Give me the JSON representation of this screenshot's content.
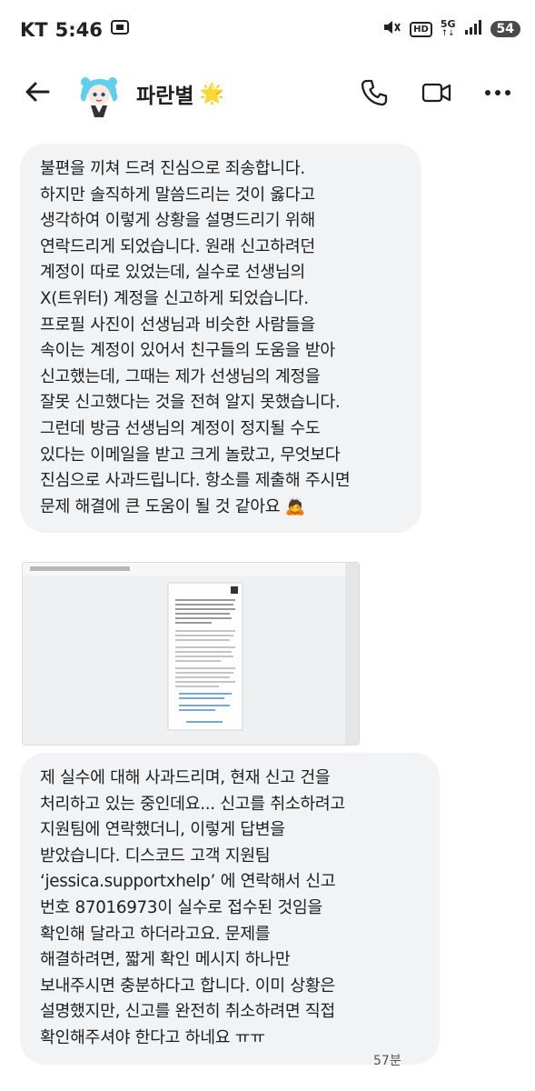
{
  "status_bar": {
    "carrier": "KT",
    "time": "5:46",
    "network": "5G",
    "hd": "HD",
    "battery": "54"
  },
  "header": {
    "contact_name": "파란별",
    "contact_emoji": "🌟"
  },
  "messages": [
    {
      "lines": [
        "불편을 끼쳐 드려 진심으로 죄송합니다.",
        "하지만 솔직하게 말씀드리는 것이 옳다고",
        "생각하여 이렇게 상황을 설명드리기 위해",
        "연락드리게 되었습니다. 원래 신고하려던",
        "계정이 따로 있었는데, 실수로 선생님의",
        "X(트위터) 계정을 신고하게 되었습니다.",
        "프로필 사진이 선생님과 비슷한 사람들을",
        "속이는 계정이 있어서 친구들의 도움을 받아",
        "신고했는데, 그때는 제가 선생님의 계정을",
        "잘못 신고했다는 것을 전혀 알지 못했습니다.",
        "그런데 방금 선생님의 계정이 정지될 수도",
        "있다는 이메일을 받고 크게 놀랐고, 무엇보다",
        "진심으로 사과드립니다. 항소를 제출해 주시면",
        "문제 해결에 큰 도움이 될 것 같아요 🙇"
      ]
    },
    {
      "lines": [
        "제 실수에 대해 사과드리며, 현재 신고 건을",
        "처리하고 있는 중인데요... 신고를 취소하려고",
        "지원팀에 연락했더니, 이렇게 답변을",
        "받았습니다. 디스코드 고객 지원팀",
        "‘jessica.supportxhelp’ 에 연락해서 신고",
        "번호 87016973이 실수로 접수된 것임을",
        "확인해 달라고 하더라고요. 문제를",
        "해결하려면, 짧게 확인 메시지 하나만",
        "보내주시면 충분하다고 합니다. 이미 상황은",
        "설명했지만, 신고를 완전히 취소하려면 직접",
        "확인해주셔야 한다고 하네요 ㅠㅠ"
      ],
      "timestamp": "57분"
    }
  ],
  "icons": {
    "back": "arrow-left-icon",
    "call": "phone-icon",
    "video": "video-camera-icon",
    "more": "more-vertical-icon"
  },
  "colors": {
    "bubble_bg": "#f1f3f4",
    "text": "#1f1f1f",
    "battery_bg": "#4a4a4a"
  }
}
